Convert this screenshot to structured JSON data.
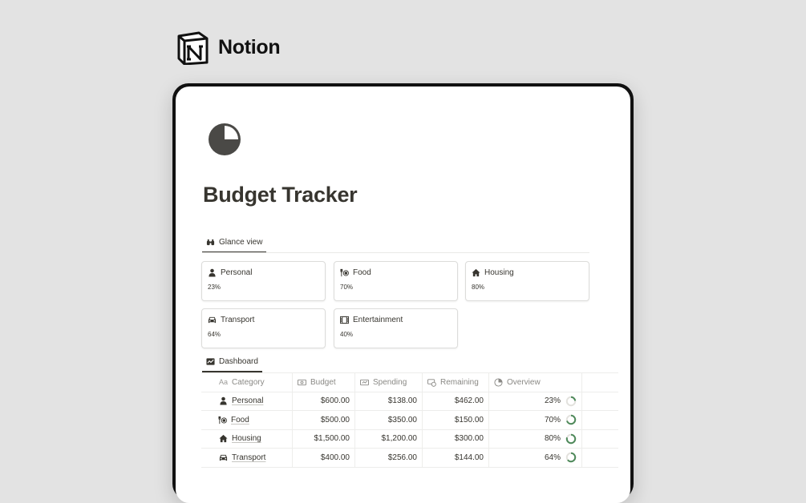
{
  "brand": {
    "name": "Notion",
    "logo_icon": "notion-logo-icon"
  },
  "page": {
    "icon": "pie-chart-icon",
    "title": "Budget Tracker"
  },
  "glance": {
    "tab_label": "Glance view",
    "tab_icon": "binoculars-icon",
    "cards": [
      {
        "label": "Personal",
        "icon": "person-icon",
        "value": "23%"
      },
      {
        "label": "Food",
        "icon": "dining-icon",
        "value": "70%"
      },
      {
        "label": "Housing",
        "icon": "house-icon",
        "value": "80%"
      },
      {
        "label": "Transport",
        "icon": "car-icon",
        "value": "64%"
      },
      {
        "label": "Entertainment",
        "icon": "film-icon",
        "value": "40%"
      }
    ]
  },
  "dashboard": {
    "tab_label": "Dashboard",
    "tab_icon": "chart-icon",
    "columns": {
      "category": "Category",
      "category_prefix": "Aa",
      "budget": "Budget",
      "spending": "Spending",
      "remaining": "Remaining",
      "overview": "Overview"
    },
    "rows": [
      {
        "category": "Personal",
        "icon": "person-icon",
        "budget": "$600.00",
        "spending": "$138.00",
        "remaining": "$462.00",
        "overview": "23%",
        "progress": 0.23
      },
      {
        "category": "Food",
        "icon": "dining-icon",
        "budget": "$500.00",
        "spending": "$350.00",
        "remaining": "$150.00",
        "overview": "70%",
        "progress": 0.7
      },
      {
        "category": "Housing",
        "icon": "house-icon",
        "budget": "$1,500.00",
        "spending": "$1,200.00",
        "remaining": "$300.00",
        "overview": "80%",
        "progress": 0.8
      },
      {
        "category": "Transport",
        "icon": "car-icon",
        "budget": "$400.00",
        "spending": "$256.00",
        "remaining": "$144.00",
        "overview": "64%",
        "progress": 0.64
      }
    ]
  },
  "colors": {
    "text": "#37352f",
    "muted": "#8a8985",
    "progress": "#4f8a5b",
    "track": "#e3e2de",
    "background": "#e3e3e3"
  }
}
